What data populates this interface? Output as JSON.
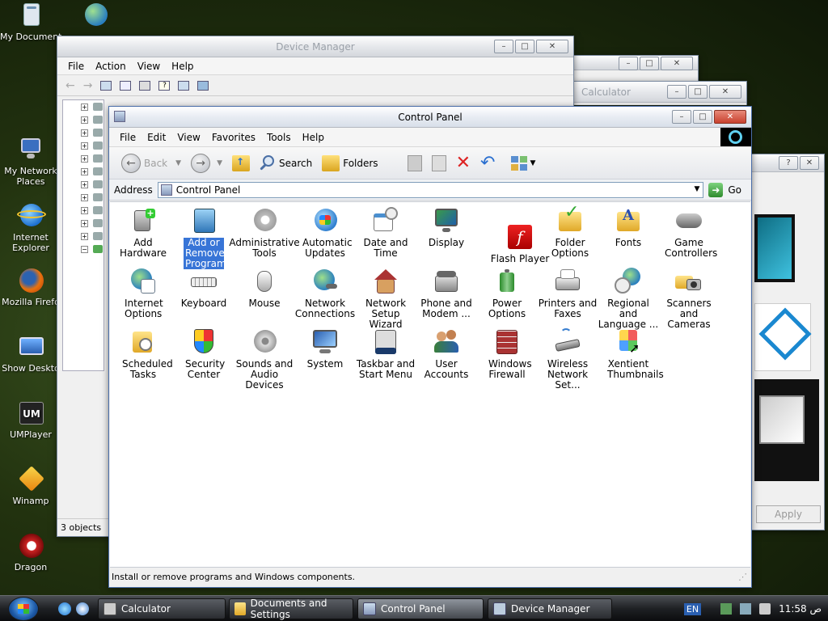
{
  "desktop": {
    "icons": [
      {
        "label": "My Documents"
      },
      {
        "label": "My Network Places"
      },
      {
        "label": "Internet Explorer"
      },
      {
        "label": "Mozilla Firefo"
      },
      {
        "label": "Show Deskto"
      },
      {
        "label": "UMPlayer"
      },
      {
        "label": "Winamp"
      },
      {
        "label": "Dragon"
      }
    ]
  },
  "device_manager": {
    "title": "Device Manager",
    "menu": [
      "File",
      "Action",
      "View",
      "Help"
    ],
    "status": "3 objects"
  },
  "calculator": {
    "title": "Calculator"
  },
  "dialog": {
    "apply_label": "Apply"
  },
  "control_panel": {
    "title": "Control Panel",
    "menu": [
      "File",
      "Edit",
      "View",
      "Favorites",
      "Tools",
      "Help"
    ],
    "toolbar": {
      "back": "Back",
      "search": "Search",
      "folders": "Folders"
    },
    "address": {
      "label": "Address",
      "value": "Control Panel",
      "go": "Go"
    },
    "items": [
      {
        "label": "Add Hardware"
      },
      {
        "label": "Add or Remove Programs"
      },
      {
        "label": "Administrative Tools"
      },
      {
        "label": "Automatic Updates"
      },
      {
        "label": "Date and Time"
      },
      {
        "label": "Display"
      },
      {
        "label": "Flash Player"
      },
      {
        "label": "Folder Options"
      },
      {
        "label": "Fonts"
      },
      {
        "label": "Game Controllers"
      },
      {
        "label": "Internet Options"
      },
      {
        "label": "Keyboard"
      },
      {
        "label": "Mouse"
      },
      {
        "label": "Network Connections"
      },
      {
        "label": "Network Setup Wizard"
      },
      {
        "label": "Phone and Modem ..."
      },
      {
        "label": "Power Options"
      },
      {
        "label": "Printers and Faxes"
      },
      {
        "label": "Regional and Language ..."
      },
      {
        "label": "Scanners and Cameras"
      },
      {
        "label": "Scheduled Tasks"
      },
      {
        "label": "Security Center"
      },
      {
        "label": "Sounds and Audio Devices"
      },
      {
        "label": "System"
      },
      {
        "label": "Taskbar and Start Menu"
      },
      {
        "label": "User Accounts"
      },
      {
        "label": "Windows Firewall"
      },
      {
        "label": "Wireless Network Set..."
      },
      {
        "label": "Xentient Thumbnails"
      }
    ],
    "status": "Install or remove programs and Windows components."
  },
  "taskbar": {
    "buttons": [
      {
        "label": "Calculator"
      },
      {
        "label": "Documents and Settings"
      },
      {
        "label": "Control Panel"
      },
      {
        "label": "Device Manager"
      }
    ],
    "language": "EN",
    "clock": "11:58 ص"
  },
  "colors": {
    "selection": "#3875d7",
    "titlebar_close": "#c8412e"
  }
}
